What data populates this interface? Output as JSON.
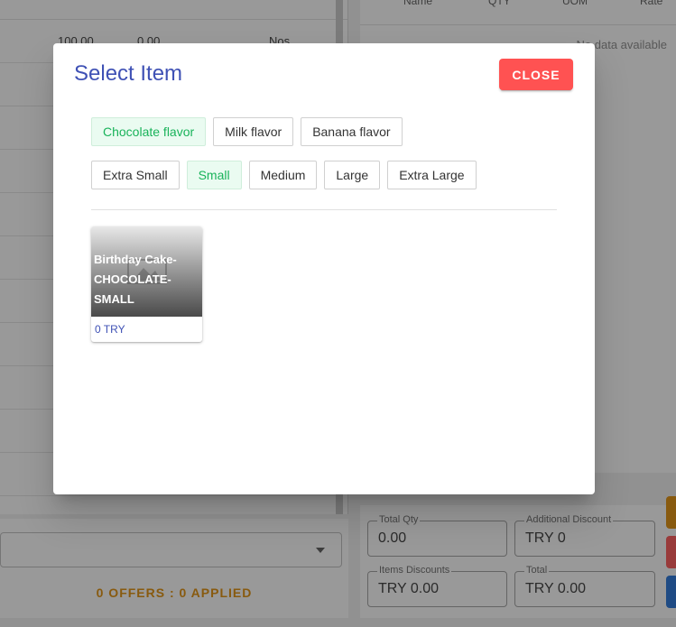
{
  "background": {
    "left_table": {
      "rows": [
        {
          "rate": "100.00",
          "available_qty": "0.00",
          "uom": "Nos"
        }
      ]
    },
    "right_table": {
      "headers": [
        "Name",
        "QTY",
        "UOM",
        "Rate"
      ],
      "empty_text": "No data available"
    },
    "offers_text": "0 OFFERS : 0 APPLIED",
    "totals": {
      "total_qty": {
        "label": "Total Qty",
        "value": "0.00"
      },
      "additional_discount": {
        "label": "Additional Discount",
        "value": "TRY 0"
      },
      "items_discounts": {
        "label": "Items Discounts",
        "value": "TRY 0.00"
      },
      "total": {
        "label": "Total",
        "value": "TRY 0.00"
      }
    },
    "colors": {
      "offers": "#e08b00",
      "btn_orange": "#e08b00",
      "btn_red": "#ff5252",
      "btn_blue": "#1e6fd9"
    }
  },
  "dialog": {
    "title": "Select Item",
    "close_label": "CLOSE",
    "flavors": [
      {
        "label": "Chocolate flavor",
        "active": true
      },
      {
        "label": "Milk flavor",
        "active": false
      },
      {
        "label": "Banana flavor",
        "active": false
      }
    ],
    "sizes": [
      {
        "label": "Extra Small",
        "active": false
      },
      {
        "label": "Small",
        "active": true
      },
      {
        "label": "Medium",
        "active": false
      },
      {
        "label": "Large",
        "active": false
      },
      {
        "label": "Extra Large",
        "active": false
      }
    ],
    "items": [
      {
        "name": "Birthday Cake-CHOCOLATE-SMALL",
        "price": "0 TRY",
        "icon": "image-placeholder-icon"
      }
    ],
    "colors": {
      "title": "#3f51b5",
      "close": "#ff5252",
      "active_chip_text": "#19b35a",
      "active_chip_bg": "#eafbf1"
    }
  }
}
